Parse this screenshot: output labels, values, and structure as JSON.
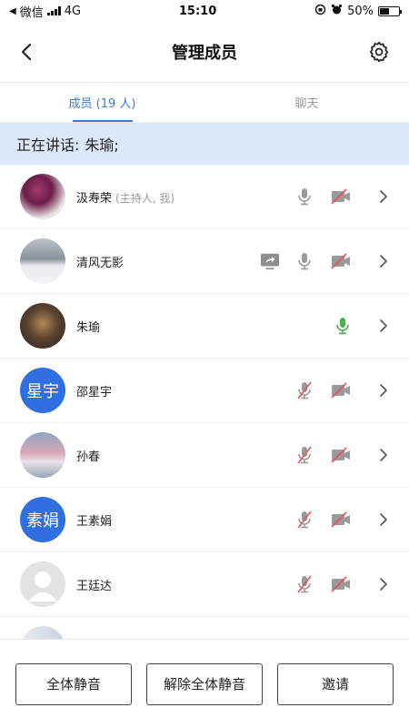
{
  "status_bar": {
    "back_app": "微信",
    "network": "4G",
    "time": "15:10",
    "battery": "50%",
    "battery_level": 0.5
  },
  "nav": {
    "title": "管理成员"
  },
  "tabs": [
    {
      "label": "成员 (19 人)",
      "active": true
    },
    {
      "label": "聊天",
      "active": false
    }
  ],
  "speaking": {
    "label": "正在讲话:",
    "names": "朱瑜;"
  },
  "members": [
    {
      "name": "汲寿荣",
      "role": "(主持人, 我)",
      "avatar": "photo-flowers",
      "sharing": false,
      "mic": "on-gray",
      "camera": "off"
    },
    {
      "name": "清风无影",
      "role": "",
      "avatar": "photo-winter",
      "sharing": true,
      "mic": "on-gray",
      "camera": "off"
    },
    {
      "name": "朱瑜",
      "role": "",
      "avatar": "photo-dark",
      "sharing": false,
      "mic": "on-green",
      "camera": "none"
    },
    {
      "name": "邵星宇",
      "role": "",
      "avatar": "text",
      "avatar_text": "星宇",
      "sharing": false,
      "mic": "muted",
      "camera": "off"
    },
    {
      "name": "孙春",
      "role": "",
      "avatar": "photo-sky",
      "sharing": false,
      "mic": "muted",
      "camera": "off"
    },
    {
      "name": "王素娟",
      "role": "",
      "avatar": "text",
      "avatar_text": "素娟",
      "sharing": false,
      "mic": "muted",
      "camera": "off"
    },
    {
      "name": "王廷达",
      "role": "",
      "avatar": "default",
      "sharing": false,
      "mic": "muted",
      "camera": "off"
    },
    {
      "name": "",
      "role": "",
      "avatar": "photo-partial",
      "sharing": false,
      "mic": "none",
      "camera": "none"
    }
  ],
  "buttons": {
    "mute_all": "全体静音",
    "unmute_all": "解除全体静音",
    "invite": "邀请"
  },
  "colors": {
    "accent": "#3a78e0",
    "speaking_bg": "#dbe8f9",
    "mic_active": "#4caf50",
    "muted_red": "#e55353",
    "avatar_blue": "#2f6fe0"
  }
}
